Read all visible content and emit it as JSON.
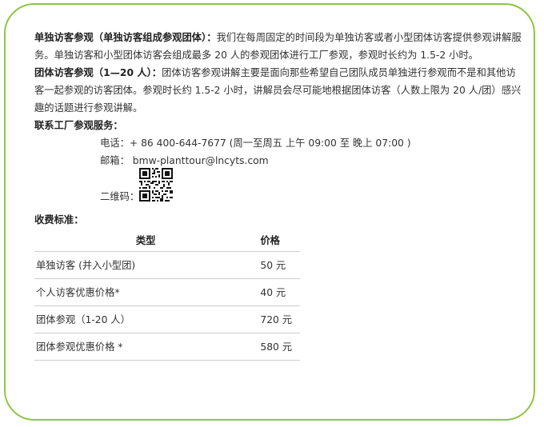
{
  "paragraphs": {
    "individual": {
      "title": "单独访客参观（单独访客组成参观团体）：",
      "text": "我们在每周固定的时间段为单独访客或者小型团体访客提供参观讲解服务。单独访客和小型团体访客会组成最多 20 人的参观团体进行工厂参观，参观时长约为 1.5-2 小时。"
    },
    "group": {
      "title": "团体访客参观（1—20 人）：",
      "text": "团体访客参观讲解主要是面向那些希望自己团队成员单独进行参观而不是和其他访客一起参观的访客团体。参观时长约 1.5-2 小时，讲解员会尽可能地根据团体访客（人数上限为 20 人/团）感兴趣的话题进行参观讲解。"
    }
  },
  "contact": {
    "title": "联系工厂参观服务：",
    "phone": "电话：+ 86 400-644-7677 (周一至周五  上午 09:00  至  晚上 07:00   )",
    "email": "邮箱：  bmw-planttour@lncyts.com",
    "qr_label": "二维码："
  },
  "fees": {
    "title": "收费标准：",
    "headers": {
      "type": "类型",
      "price": "价格"
    },
    "rows": [
      {
        "type": "单独访客 (并入小型团)",
        "price": "50  元"
      },
      {
        "type": "个人访客优惠价格*",
        "price": "40  元"
      },
      {
        "type": "团体参观（1-20 人）",
        "price": "720  元"
      },
      {
        "type": "团体参观优惠价格 *",
        "price": "580  元"
      }
    ]
  },
  "colors": {
    "border": "#8cc63f",
    "text": "#333333",
    "rule": "#cccccc"
  }
}
